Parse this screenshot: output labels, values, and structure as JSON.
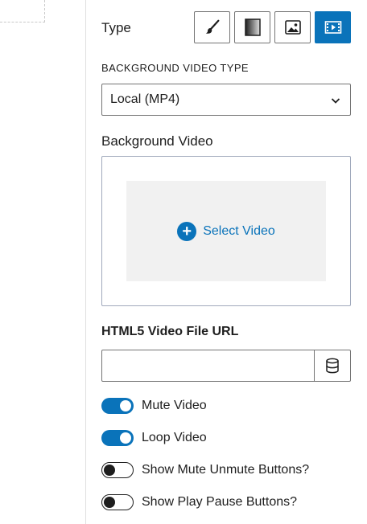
{
  "type_section": {
    "label": "Type",
    "buttons": [
      {
        "name": "classic",
        "icon": "paintbrush-icon",
        "active": false
      },
      {
        "name": "gradient",
        "icon": "gradient-icon",
        "active": false
      },
      {
        "name": "image",
        "icon": "image-icon",
        "active": false
      },
      {
        "name": "video",
        "icon": "video-icon",
        "active": true
      }
    ]
  },
  "background_video_type": {
    "label": "BACKGROUND VIDEO TYPE",
    "selected": "Local (MP4)",
    "icon": "chevron-down-icon"
  },
  "background_video": {
    "label": "Background Video",
    "select_button": "Select Video",
    "icon": "plus-circle-icon"
  },
  "html5_url": {
    "label": "HTML5 Video File URL",
    "value": "",
    "placeholder": "",
    "icon": "database-icon"
  },
  "toggles": [
    {
      "label": "Mute Video",
      "on": true
    },
    {
      "label": "Loop Video",
      "on": true
    },
    {
      "label": "Show Mute Unmute Buttons?",
      "on": false
    },
    {
      "label": "Show Play Pause Buttons?",
      "on": false
    }
  ],
  "colors": {
    "accent": "#0a73ba",
    "border": "#757575",
    "text": "#1e1e1e"
  }
}
